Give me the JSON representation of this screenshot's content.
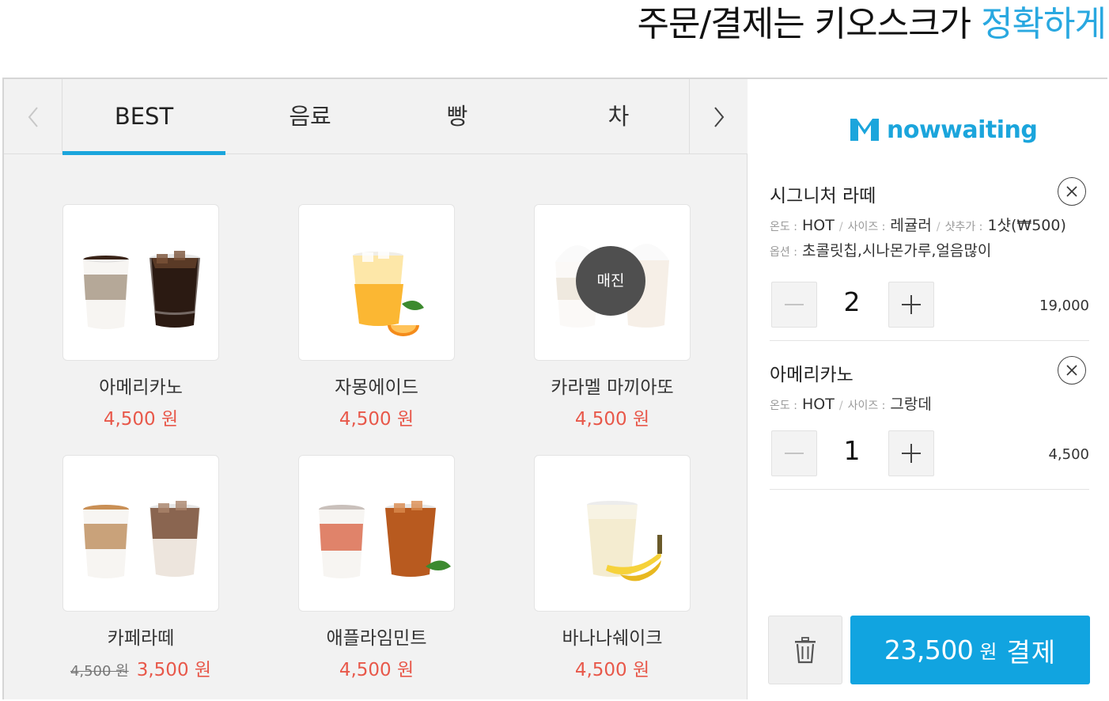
{
  "headline": {
    "text": "주문/결제는 키오스크가 ",
    "accent": "정확하게"
  },
  "colors": {
    "accent": "#1ba5dc",
    "price": "#e8584a",
    "pay_button": "#11a4e0"
  },
  "tabs": [
    {
      "label": "BEST",
      "active": true
    },
    {
      "label": "음료",
      "active": false
    },
    {
      "label": "빵",
      "active": false
    },
    {
      "label": "차",
      "active": false
    }
  ],
  "menu_items": [
    {
      "name": "아메리카노",
      "price": "4,500 원",
      "icon": "hot-and-iced-americano-image"
    },
    {
      "name": "자몽에이드",
      "price": "4,500 원",
      "icon": "grapefruit-ade-image"
    },
    {
      "name": "카라멜 마끼아또",
      "price": "4,500 원",
      "icon": "caramel-macchiato-image",
      "sold_out_label": "매진"
    },
    {
      "name": "카페라떼",
      "original_price": "4,500 원",
      "price": "3,500 원",
      "icon": "cafe-latte-image"
    },
    {
      "name": "애플라임민트",
      "price": "4,500 원",
      "icon": "apple-lime-mint-image"
    },
    {
      "name": "바나나쉐이크",
      "price": "4,500 원",
      "icon": "banana-shake-image"
    }
  ],
  "cart": {
    "logo": "nowwaiting",
    "items": [
      {
        "name": "시그니처 라떼",
        "temp_label": "온도 :",
        "temp": "HOT",
        "size_label": "사이즈 :",
        "size": "레귤러",
        "shot_label": "샷추가 :",
        "shot": "1샷(₩500)",
        "option_label": "옵션 :",
        "options": "초콜릿칩,시나몬가루,얼음많이",
        "qty": "2",
        "line_price": "19,000"
      },
      {
        "name": "아메리카노",
        "temp_label": "온도 :",
        "temp": "HOT",
        "size_label": "사이즈 :",
        "size": "그랑데",
        "qty": "1",
        "line_price": "4,500"
      }
    ],
    "total": "23,500",
    "currency": "원",
    "pay_label": "결제"
  }
}
